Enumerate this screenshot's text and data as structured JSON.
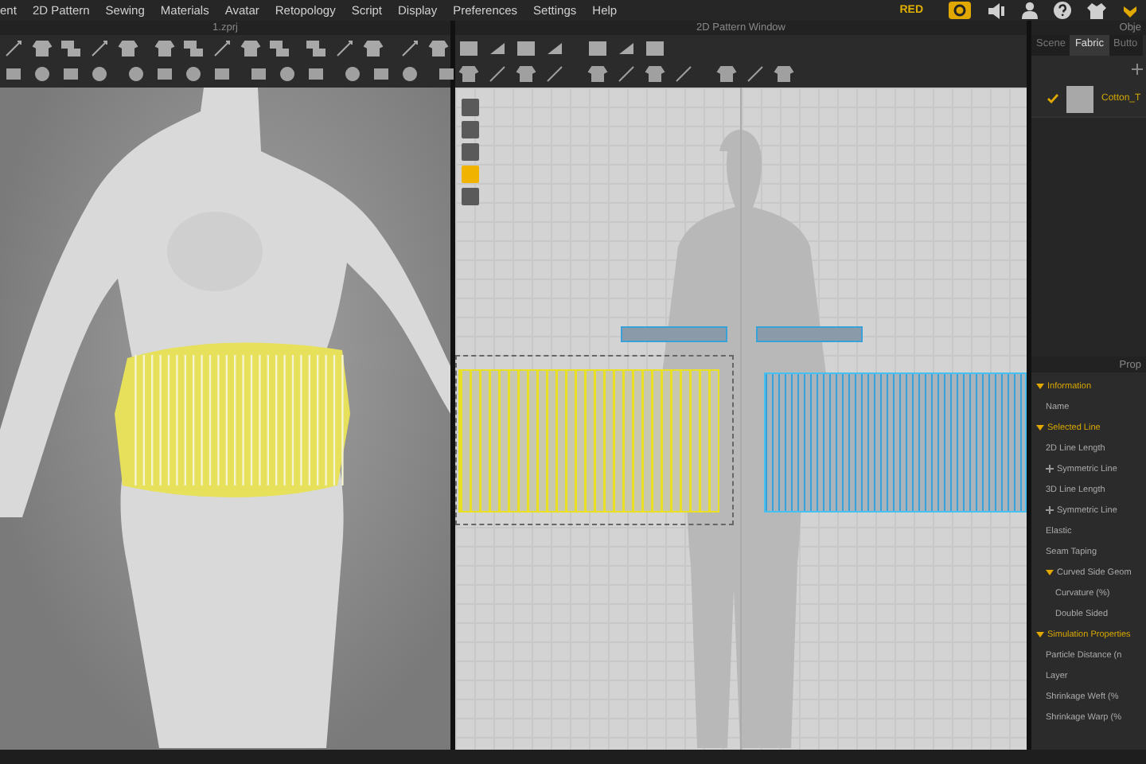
{
  "menu": [
    "ent",
    "2D Pattern",
    "Sewing",
    "Materials",
    "Avatar",
    "Retopology",
    "Script",
    "Display",
    "Preferences",
    "Settings",
    "Help"
  ],
  "mode_badge": "RED",
  "viewport_3d": {
    "title": "1.zprj"
  },
  "pattern_window": {
    "title": "2D Pattern Window"
  },
  "object_browser": {
    "title": "Obje",
    "tabs": [
      {
        "label": "Scene",
        "selected": false
      },
      {
        "label": "Fabric",
        "selected": true
      },
      {
        "label": "Butto",
        "selected": false
      }
    ],
    "fabrics": [
      {
        "name": "Cotton_T",
        "checked": true
      }
    ]
  },
  "property_editor": {
    "title": "Prop",
    "tree": [
      {
        "label": "Information",
        "expanded": true,
        "children": [
          {
            "label": "Name"
          }
        ]
      },
      {
        "label": "Selected Line",
        "expanded": true,
        "children": [
          {
            "label": "2D Line Length"
          },
          {
            "label": "Symmetric Line",
            "expanded": false
          },
          {
            "label": "3D Line Length"
          },
          {
            "label": "Symmetric Line",
            "expanded": false
          },
          {
            "label": "Elastic"
          },
          {
            "label": "Seam Taping"
          },
          {
            "label": "Curved Side Geom",
            "expanded": true,
            "children": [
              {
                "label": "Curvature (%)"
              },
              {
                "label": "Double Sided"
              }
            ]
          }
        ]
      },
      {
        "label": "Simulation Properties",
        "expanded": true,
        "children": [
          {
            "label": "Particle Distance (n"
          },
          {
            "label": "Layer"
          },
          {
            "label": "Shrinkage Weft (%"
          },
          {
            "label": "Shrinkage Warp (%"
          }
        ]
      }
    ]
  }
}
